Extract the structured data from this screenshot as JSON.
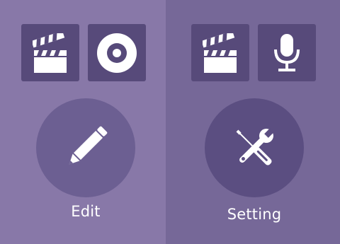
{
  "left_panel": {
    "tiles": [
      {
        "icon": "clapperboard-icon"
      },
      {
        "icon": "disc-icon"
      }
    ],
    "action": {
      "icon": "pencil-icon",
      "label": "Edit"
    }
  },
  "right_panel": {
    "tiles": [
      {
        "icon": "clapperboard-icon"
      },
      {
        "icon": "microphone-icon"
      }
    ],
    "action": {
      "icon": "tools-icon",
      "label": "Setting"
    }
  },
  "colors": {
    "left_background": "#8878a8",
    "right_background": "#766898",
    "tile_background": "#574a7a",
    "left_circle": "#6c5f92",
    "right_circle": "#5b4e81",
    "icon": "#ffffff"
  }
}
